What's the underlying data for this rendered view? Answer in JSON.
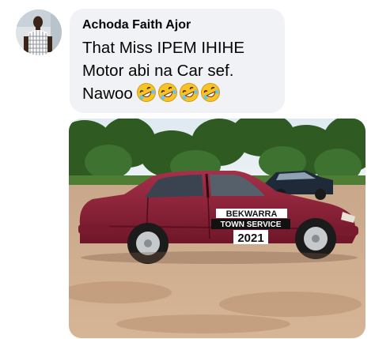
{
  "comment": {
    "author": "Achoda Faith Ajor",
    "lines": [
      "That Miss IPEM IHIHE",
      "Motor abi na Car sef.",
      "Nawoo"
    ],
    "emojis": [
      "rolling-on-floor-laughing",
      "rolling-on-floor-laughing",
      "rolling-on-floor-laughing",
      "rolling-on-floor-laughing"
    ]
  },
  "photo": {
    "sign_line1": "BEKWARRA",
    "sign_line2": "TOWN SERVICE",
    "sign_year": "2021",
    "car_color": "#8f1f35"
  }
}
